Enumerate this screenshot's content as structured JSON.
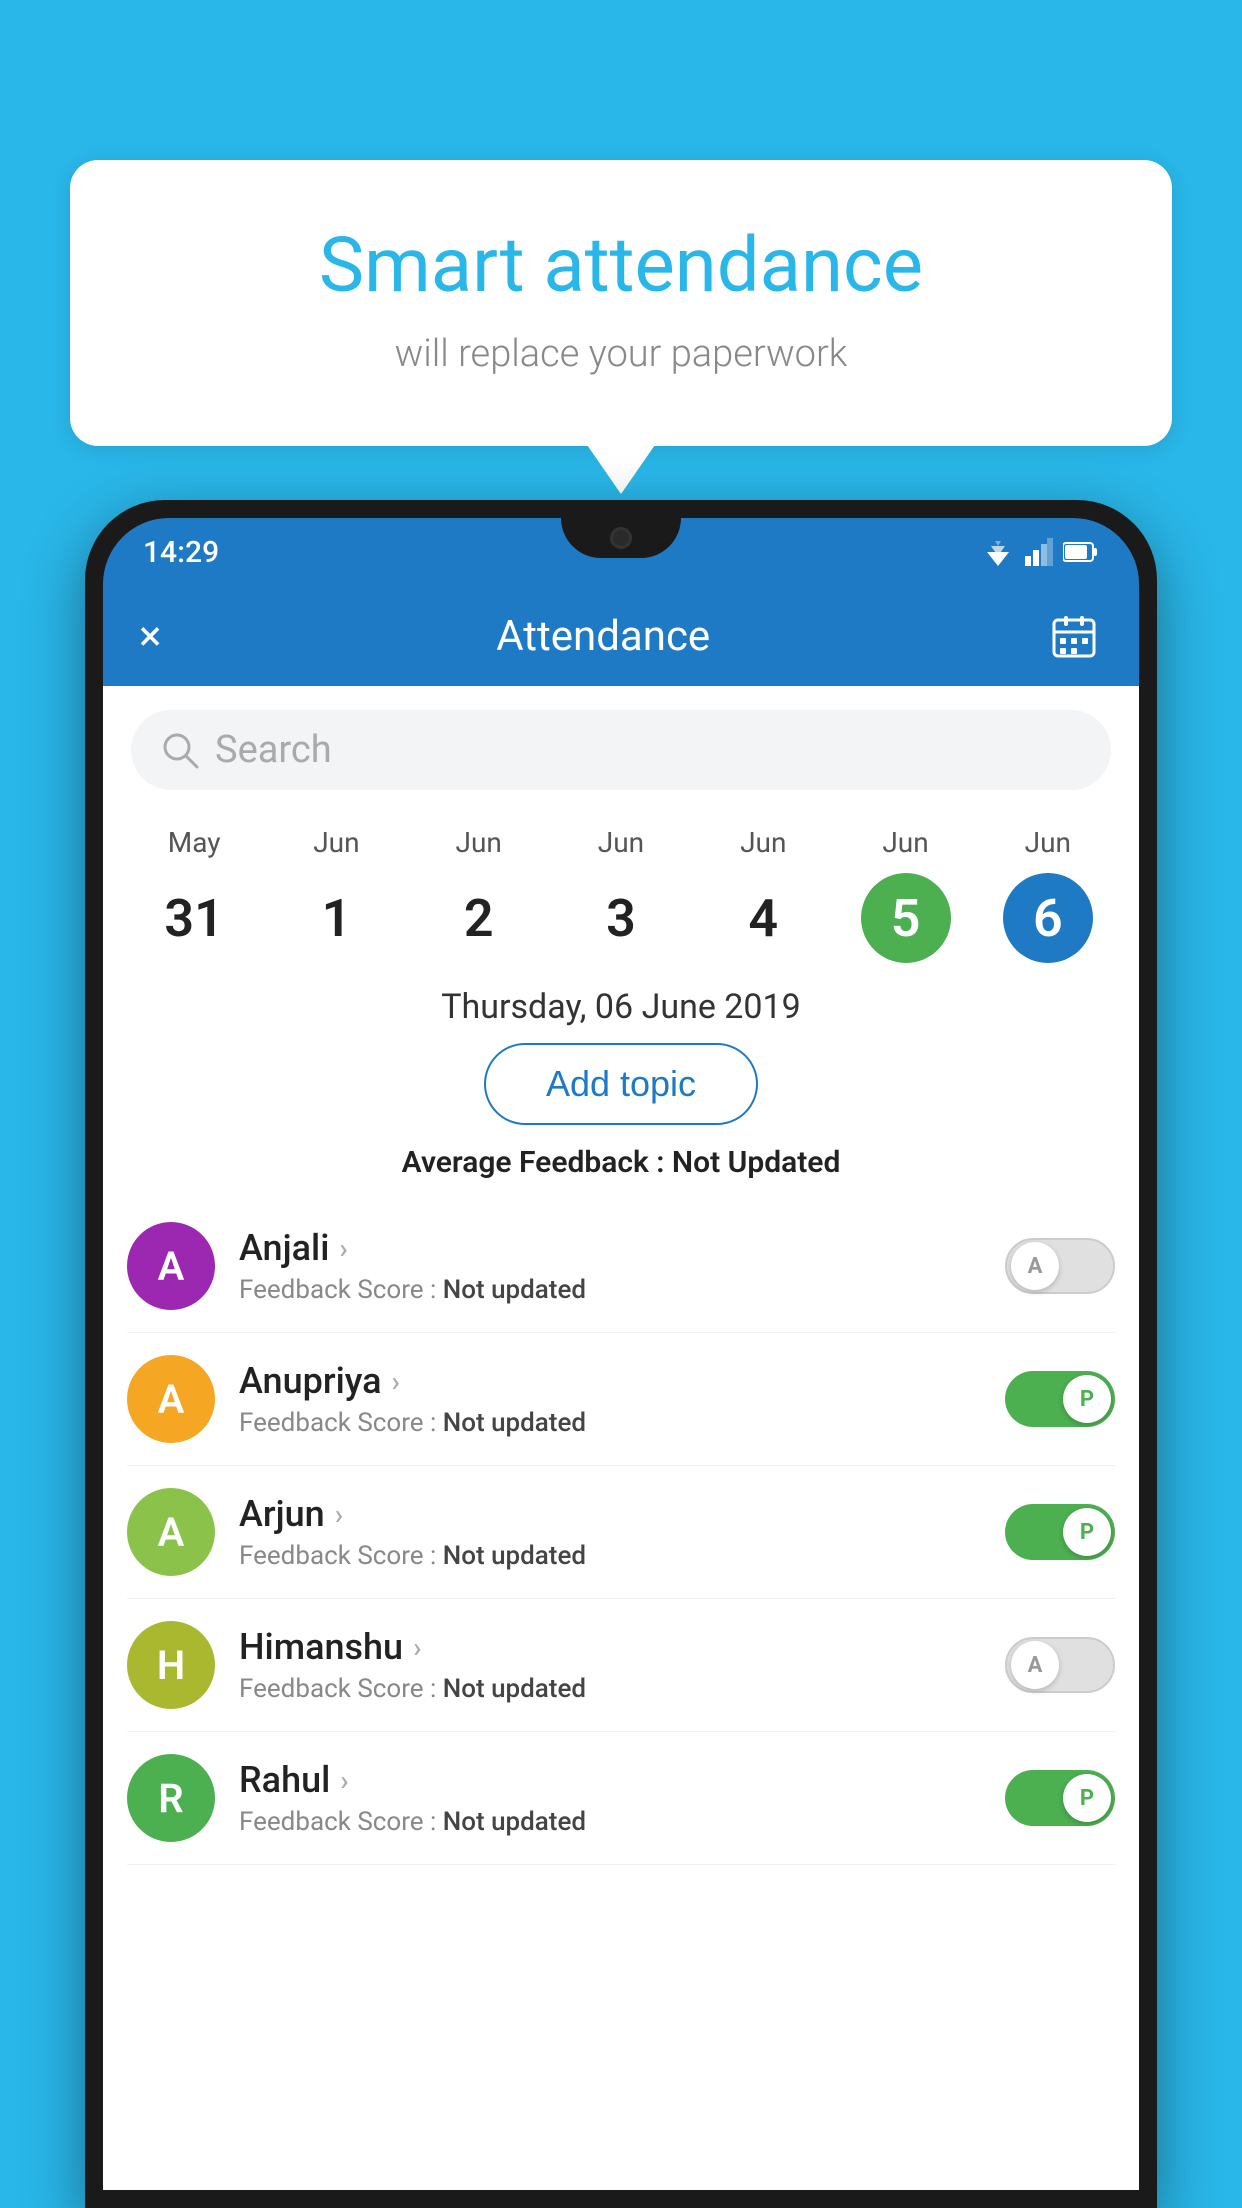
{
  "background_color": "#29b6e8",
  "bubble": {
    "title": "Smart attendance",
    "subtitle": "will replace your paperwork"
  },
  "status_bar": {
    "time": "14:29"
  },
  "app_bar": {
    "title": "Attendance",
    "close_label": "×",
    "calendar_label": "📅"
  },
  "search": {
    "placeholder": "Search"
  },
  "calendar": {
    "days": [
      {
        "month": "May",
        "number": "31",
        "highlight": ""
      },
      {
        "month": "Jun",
        "number": "1",
        "highlight": ""
      },
      {
        "month": "Jun",
        "number": "2",
        "highlight": ""
      },
      {
        "month": "Jun",
        "number": "3",
        "highlight": ""
      },
      {
        "month": "Jun",
        "number": "4",
        "highlight": ""
      },
      {
        "month": "Jun",
        "number": "5",
        "highlight": "today"
      },
      {
        "month": "Jun",
        "number": "6",
        "highlight": "selected"
      }
    ]
  },
  "selected_date": "Thursday, 06 June 2019",
  "add_topic_label": "Add topic",
  "avg_feedback_label": "Average Feedback :",
  "avg_feedback_value": "Not Updated",
  "students": [
    {
      "name": "Anjali",
      "avatar_letter": "A",
      "avatar_color": "#9c27b0",
      "feedback_label": "Feedback Score :",
      "feedback_value": "Not updated",
      "toggle": "off",
      "toggle_letter": "A"
    },
    {
      "name": "Anupriya",
      "avatar_letter": "A",
      "avatar_color": "#f5a623",
      "feedback_label": "Feedback Score :",
      "feedback_value": "Not updated",
      "toggle": "on",
      "toggle_letter": "P"
    },
    {
      "name": "Arjun",
      "avatar_letter": "A",
      "avatar_color": "#8bc34a",
      "feedback_label": "Feedback Score :",
      "feedback_value": "Not updated",
      "toggle": "on",
      "toggle_letter": "P"
    },
    {
      "name": "Himanshu",
      "avatar_letter": "H",
      "avatar_color": "#aab830",
      "feedback_label": "Feedback Score :",
      "feedback_value": "Not updated",
      "toggle": "off",
      "toggle_letter": "A"
    },
    {
      "name": "Rahul",
      "avatar_letter": "R",
      "avatar_color": "#4caf50",
      "feedback_label": "Feedback Score :",
      "feedback_value": "Not updated",
      "toggle": "on",
      "toggle_letter": "P"
    }
  ]
}
